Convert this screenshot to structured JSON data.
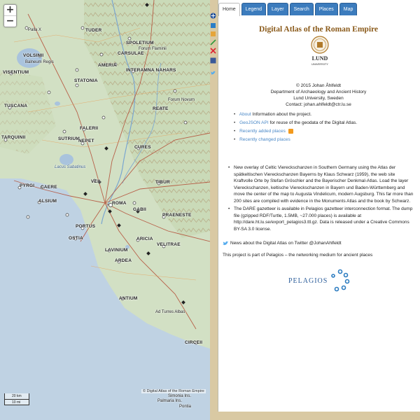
{
  "map": {
    "zoom_in": "+",
    "zoom_out": "−",
    "scale_km": "20 km",
    "scale_mi": "10 mi",
    "credit": "© Digital Atlas of the Roman Empire",
    "places": [
      {
        "name": "Palla X",
        "cls": ""
      },
      {
        "name": "TUDER",
        "cls": "big"
      },
      {
        "name": "SPOLETIUM",
        "cls": "big"
      },
      {
        "name": "VOLSINII",
        "cls": "big"
      },
      {
        "name": "Balneum Regis",
        "cls": ""
      },
      {
        "name": "CARSULAE",
        "cls": "big"
      },
      {
        "name": "Forum Flaminii",
        "cls": ""
      },
      {
        "name": "VISENTIUM",
        "cls": "big"
      },
      {
        "name": "AMERIA",
        "cls": "big"
      },
      {
        "name": "INTERAMNA NAHARS",
        "cls": "big"
      },
      {
        "name": "STATONIA",
        "cls": "big"
      },
      {
        "name": "TUSCANA",
        "cls": "big"
      },
      {
        "name": "Forum Novum",
        "cls": ""
      },
      {
        "name": "REATE",
        "cls": "big"
      },
      {
        "name": "TARQUINII",
        "cls": "big"
      },
      {
        "name": "FALERII",
        "cls": "big"
      },
      {
        "name": "CURES",
        "cls": "big"
      },
      {
        "name": "SUTRIUM",
        "cls": "big"
      },
      {
        "name": "NEPET",
        "cls": "big"
      },
      {
        "name": "Lacus Sabatinus",
        "cls": "water"
      },
      {
        "name": "VEII",
        "cls": "big"
      },
      {
        "name": "CAERE",
        "cls": "big"
      },
      {
        "name": "PYRGI",
        "cls": "big"
      },
      {
        "name": "ROMA",
        "cls": "big"
      },
      {
        "name": "TIBUR",
        "cls": "big"
      },
      {
        "name": "ALSIUM",
        "cls": "big"
      },
      {
        "name": "GABII",
        "cls": "big"
      },
      {
        "name": "PRAENESTE",
        "cls": "big"
      },
      {
        "name": "PORTUS",
        "cls": "big"
      },
      {
        "name": "OSTIA",
        "cls": "big"
      },
      {
        "name": "LAVINIUM",
        "cls": "big"
      },
      {
        "name": "ARICIA",
        "cls": "big"
      },
      {
        "name": "VELITRAE",
        "cls": "big"
      },
      {
        "name": "ARDEA",
        "cls": "big"
      },
      {
        "name": "ANTIUM",
        "cls": "big"
      },
      {
        "name": "Ad Turres Albas",
        "cls": ""
      },
      {
        "name": "CIRCEII",
        "cls": "big"
      },
      {
        "name": "Simonia Ins.",
        "cls": ""
      },
      {
        "name": "Palmaria Ins.",
        "cls": ""
      },
      {
        "name": "Pontia",
        "cls": ""
      }
    ]
  },
  "tabs": [
    {
      "label": "Home",
      "active": true
    },
    {
      "label": "Legend",
      "active": false
    },
    {
      "label": "Layer",
      "active": false
    },
    {
      "label": "Search",
      "active": false
    },
    {
      "label": "Places",
      "active": false
    },
    {
      "label": "Map",
      "active": false
    }
  ],
  "home": {
    "title": "Digital Atlas of the Roman Empire",
    "logo_line1": "LUND",
    "logo_line2": "UNIVERSITY",
    "address": [
      "© 2015 Johan Åhlfeldt",
      "Department of Archaeology and Ancient History",
      "Lund University, Sweden",
      "Contact: johan.ahlfeldt@ctr.lu.se"
    ],
    "links": [
      {
        "link": "About",
        "text": " Information about the project."
      },
      {
        "link": "GeoJSON API",
        "text": " for reuse of the geodata of the Digital Atlas."
      },
      {
        "link": "Recently added places",
        "text": ""
      },
      {
        "link": "Recently changed places",
        "text": ""
      }
    ],
    "news1": "New overlay of Celtic Viereckschanzen in Southern Germany using the Atlas der spätkeltischen Viereckschanzen Bayerns by Klaus Schwarz (1959), the web site Kraftvolle Orte by Stefan Gröschler and the Bayerischer Denkmal-Atlas. Load the layer Viereckschanzen, keltische Viereckschanzen in Bayern und Baden-Württemberg and move the center of the map to Augusta Vindelicum, modern Augsburg. This far more than 200 sites are compiled with evidence in the Monuments Atlas and the book by Schwarz.",
    "news2": "The DARE gazetteer is available in Pelagios gazetteer interconnection format. The dump file (gzipped RDF/Turtle, 1.5MB, ~27.000 places) is available at http://dare.ht.lu.se/export_pelagios3.ttl.gz. Data is released under a Creative Commons BY-SA 3.0 license.",
    "twitter": "News about the Digital Atlas on Twitter @JohanAhlfeldt",
    "pelagios_line": "This project is part of Pelagios – the networking medium for ancient places",
    "pelagios_logo": "PELAGIOS"
  }
}
